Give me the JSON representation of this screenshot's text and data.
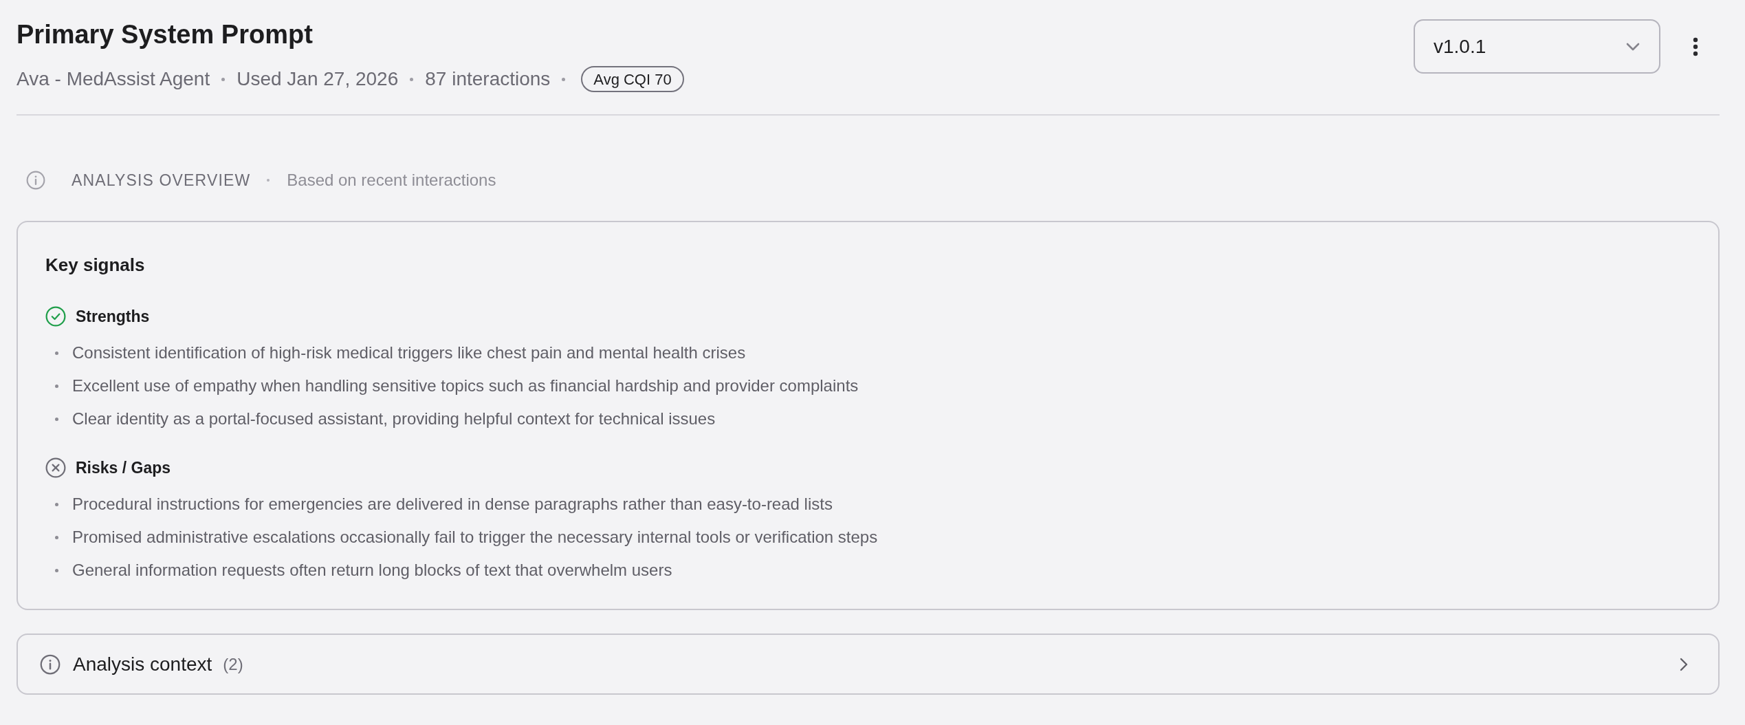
{
  "header": {
    "title": "Primary System Prompt",
    "meta": [
      "Ava - MedAssist Agent",
      "Used Jan 27, 2026",
      "87 interactions"
    ],
    "badge": "Avg CQI 70",
    "version_select": {
      "value": "v1.0.1"
    }
  },
  "analysis_overview": {
    "label": "ANALYSIS OVERVIEW",
    "note": "Based on recent interactions"
  },
  "key_signals": {
    "title": "Key signals",
    "groups": [
      {
        "kind": "strengths",
        "label": "Strengths",
        "items": [
          "Consistent identification of high-risk medical triggers like chest pain and mental health crises",
          "Excellent use of empathy when handling sensitive topics such as financial hardship and provider complaints",
          "Clear identity as a portal-focused assistant, providing helpful context for technical issues"
        ]
      },
      {
        "kind": "risks",
        "label": "Risks / Gaps",
        "items": [
          "Procedural instructions for emergencies are delivered in dense paragraphs rather than easy-to-read lists",
          "Promised administrative escalations occasionally fail to trigger the necessary internal tools or verification steps",
          "General information requests often return long blocks of text that overwhelm users"
        ]
      }
    ]
  },
  "analysis_context": {
    "label": "Analysis context",
    "count": "(2)",
    "expanded": false
  }
}
